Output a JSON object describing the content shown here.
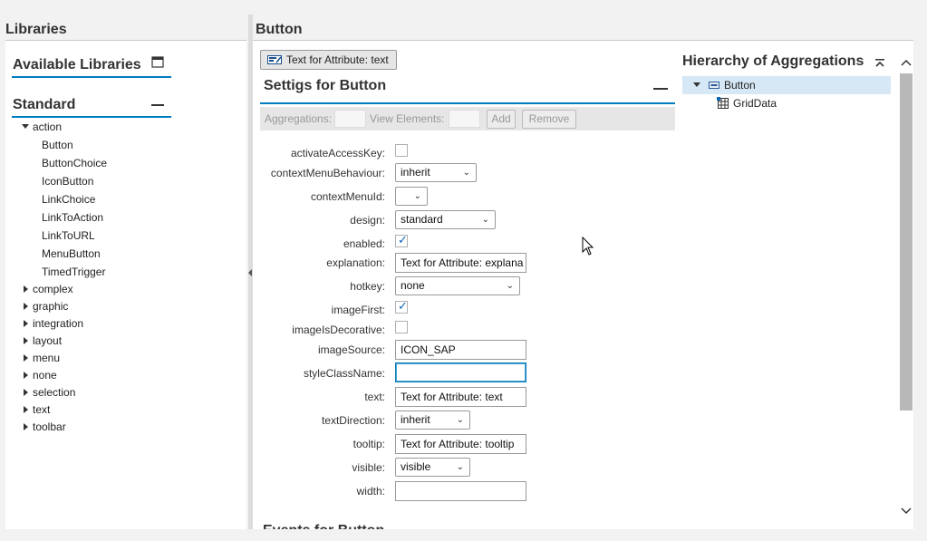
{
  "libraries": {
    "title": "Libraries",
    "available_title": "Available Libraries",
    "standard_title": "Standard",
    "expanded_group": "action",
    "action_children": [
      "Button",
      "ButtonChoice",
      "IconButton",
      "LinkChoice",
      "LinkToAction",
      "LinkToURL",
      "MenuButton",
      "TimedTrigger"
    ],
    "other_groups": [
      "complex",
      "graphic",
      "integration",
      "layout",
      "menu",
      "none",
      "selection",
      "text",
      "toolbar"
    ]
  },
  "main": {
    "title": "Button",
    "toolbar_button": "Text for Attribute: text",
    "settings_title": "Settigs for Button",
    "aggregations_label": "Aggregations:",
    "view_elements_label": "View Elements:",
    "add_label": "Add",
    "remove_label": "Remove",
    "events_title": "Events for Button"
  },
  "properties": {
    "activateAccessKey": {
      "label": "activateAccessKey:",
      "checked": false
    },
    "contextMenuBehaviour": {
      "label": "contextMenuBehaviour:",
      "value": "inherit"
    },
    "contextMenuId": {
      "label": "contextMenuId:",
      "value": ""
    },
    "design": {
      "label": "design:",
      "value": "standard"
    },
    "enabled": {
      "label": "enabled:",
      "checked": true
    },
    "explanation": {
      "label": "explanation:",
      "value": "Text for Attribute: explana"
    },
    "hotkey": {
      "label": "hotkey:",
      "value": "none"
    },
    "imageFirst": {
      "label": "imageFirst:",
      "checked": true
    },
    "imageIsDecorative": {
      "label": "imageIsDecorative:",
      "checked": false
    },
    "imageSource": {
      "label": "imageSource:",
      "value": "ICON_SAP"
    },
    "styleClassName": {
      "label": "styleClassName:",
      "value": ""
    },
    "text": {
      "label": "text:",
      "value": "Text for Attribute: text"
    },
    "textDirection": {
      "label": "textDirection:",
      "value": "inherit"
    },
    "tooltip": {
      "label": "tooltip:",
      "value": "Text for Attribute: tooltip"
    },
    "visible": {
      "label": "visible:",
      "value": "visible"
    },
    "width": {
      "label": "width:",
      "value": ""
    }
  },
  "hierarchy": {
    "title": "Hierarchy of Aggregations",
    "root": "Button",
    "child": "GridData"
  },
  "colors": {
    "accent": "#007cc0",
    "selected_row": "#d6e8f5",
    "checkmark": "#0a66b7"
  }
}
